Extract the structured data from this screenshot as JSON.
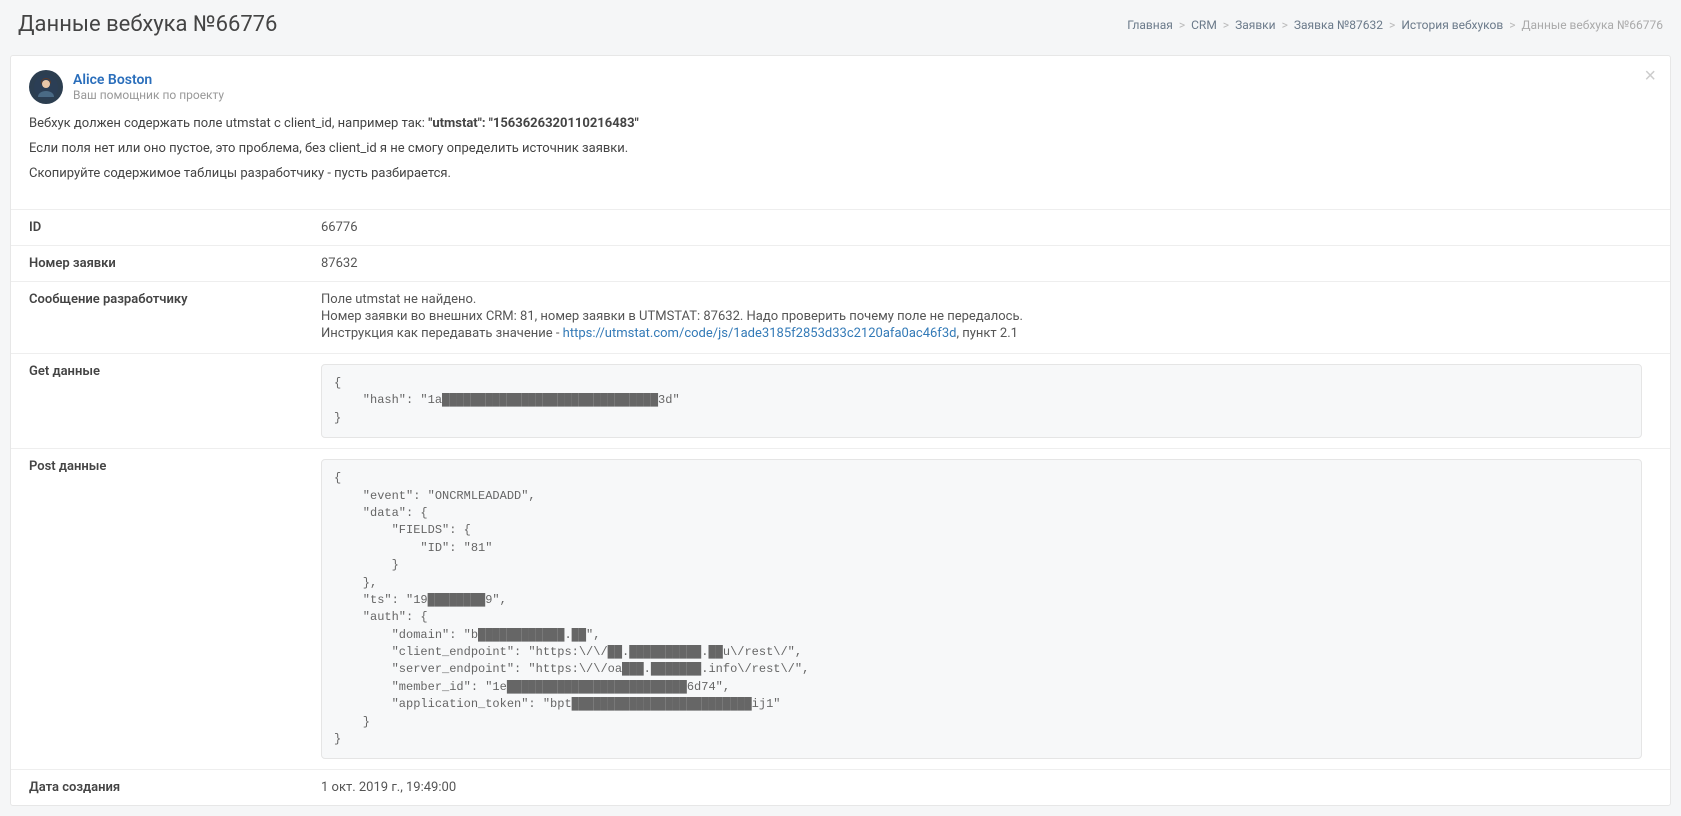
{
  "header": {
    "title": "Данные вебхука №66776"
  },
  "breadcrumb": {
    "items": [
      {
        "label": "Главная"
      },
      {
        "label": "CRM"
      },
      {
        "label": "Заявки"
      },
      {
        "label": "Заявка №87632"
      },
      {
        "label": "История вебхуков"
      }
    ],
    "current": "Данные вебхука №66776"
  },
  "alert": {
    "name": "Alice Boston",
    "subtitle": "Ваш помощник по проекту",
    "line1_prefix": "Вебхук должен содержать поле utmstat c client_id, например так: ",
    "line1_bold": "\"utmstat\": \"1563626320110216483\"",
    "line2": "Если поля нет или оно пустое, это проблема, без client_id я не смогу определить источник заявки.",
    "line3": "Скопируйте содержимое таблицы разработчику - пусть разбирается."
  },
  "rows": {
    "id": {
      "label": "ID",
      "value": "66776"
    },
    "order": {
      "label": "Номер заявки",
      "value": "87632"
    },
    "dev_msg": {
      "label": "Сообщение разработчику",
      "l1": "Поле utmstat не найдено.",
      "l2": "Номер заявки во внешних CRM: 81, номер заявки в UTMSTAT: 87632. Надо проверить почему поле не передалось.",
      "l3_prefix": "Инструкция как передавать значение - ",
      "l3_link": "https://utmstat.com/code/js/1ade3185f2853d33c2120afa0ac46f3d",
      "l3_suffix": ", пункт 2.1"
    },
    "get": {
      "label": "Get данные",
      "code": "{\n    \"hash\": \"1a██████████████████████████████3d\"\n}"
    },
    "post": {
      "label": "Post данные",
      "code": "{\n    \"event\": \"ONCRMLEADADD\",\n    \"data\": {\n        \"FIELDS\": {\n            \"ID\": \"81\"\n        }\n    },\n    \"ts\": \"19████████9\",\n    \"auth\": {\n        \"domain\": \"b████████████.██\",\n        \"client_endpoint\": \"https:\\/\\/██.██████████.██u\\/rest\\/\",\n        \"server_endpoint\": \"https:\\/\\/oa███.███████.info\\/rest\\/\",\n        \"member_id\": \"1e█████████████████████████6d74\",\n        \"application_token\": \"bpt█████████████████████████ij1\"\n    }\n}"
    },
    "created": {
      "label": "Дата создания",
      "value": "1 окт. 2019 г., 19:49:00"
    }
  }
}
